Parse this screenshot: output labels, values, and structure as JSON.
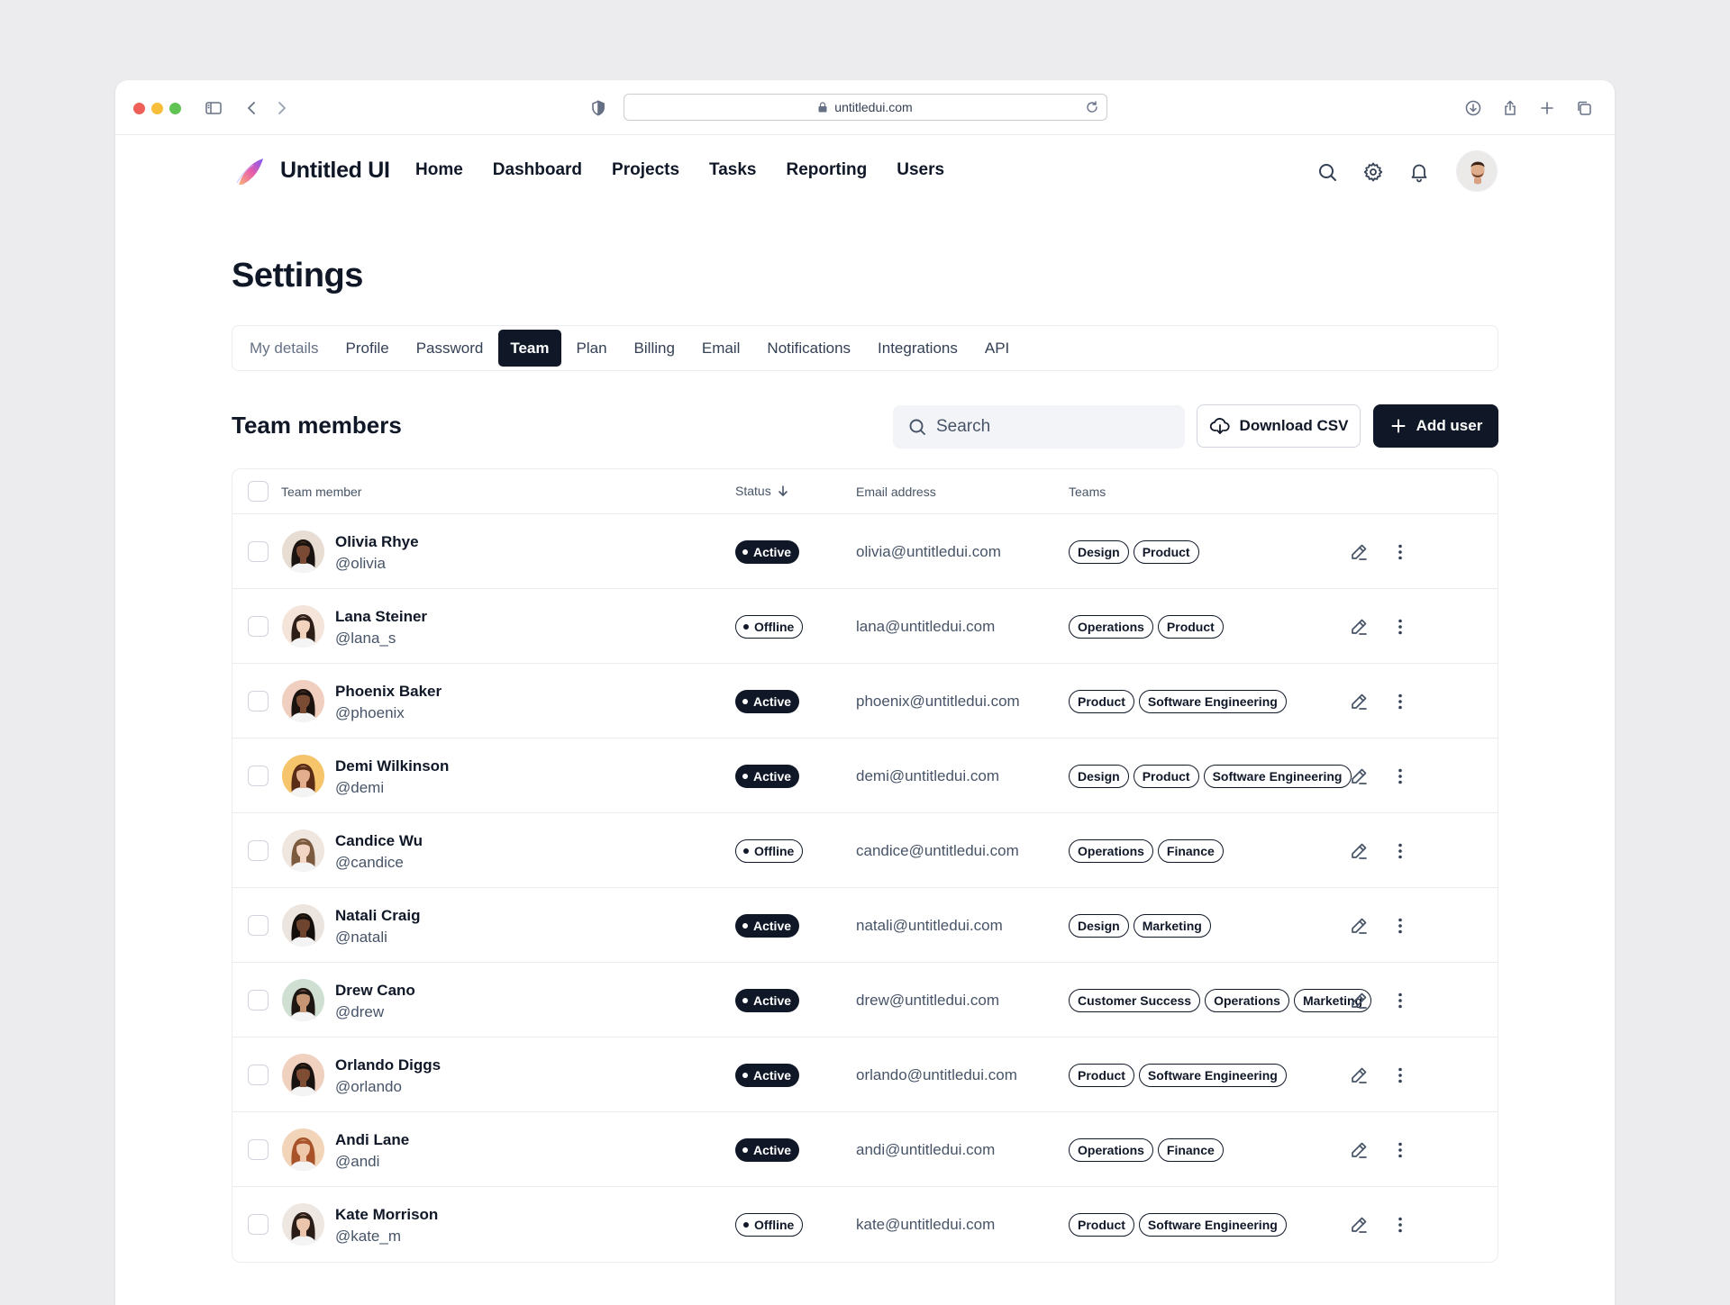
{
  "browser": {
    "url": "untitledui.com"
  },
  "brand": {
    "name": "Untitled UI"
  },
  "nav": {
    "links": [
      "Home",
      "Dashboard",
      "Projects",
      "Tasks",
      "Reporting",
      "Users"
    ],
    "icons": [
      "search-icon",
      "gear-icon",
      "bell-icon"
    ]
  },
  "page": {
    "title": "Settings"
  },
  "tabs": [
    {
      "label": "My details",
      "active": false
    },
    {
      "label": "Profile",
      "active": false
    },
    {
      "label": "Password",
      "active": false
    },
    {
      "label": "Team",
      "active": true
    },
    {
      "label": "Plan",
      "active": false
    },
    {
      "label": "Billing",
      "active": false
    },
    {
      "label": "Email",
      "active": false
    },
    {
      "label": "Notifications",
      "active": false
    },
    {
      "label": "Integrations",
      "active": false
    },
    {
      "label": "API",
      "active": false
    }
  ],
  "section": {
    "title": "Team members",
    "search_placeholder": "Search",
    "download_label": "Download CSV",
    "add_label": "Add user"
  },
  "table": {
    "headers": {
      "member": "Team member",
      "status": "Status",
      "email": "Email address",
      "teams": "Teams"
    },
    "rows": [
      {
        "name": "Olivia Rhye",
        "handle": "@olivia",
        "status": "Active",
        "email": "olivia@untitledui.com",
        "teams": [
          "Design",
          "Product"
        ],
        "skin": "#7a4a34",
        "hair": "#1a1410",
        "bg": "#e7ddd2"
      },
      {
        "name": "Lana Steiner",
        "handle": "@lana_s",
        "status": "Offline",
        "email": "lana@untitledui.com",
        "teams": [
          "Operations",
          "Product"
        ],
        "skin": "#f2d3bd",
        "hair": "#2d1f18",
        "bg": "#f4e4da"
      },
      {
        "name": "Phoenix Baker",
        "handle": "@phoenix",
        "status": "Active",
        "email": "phoenix@untitledui.com",
        "teams": [
          "Product",
          "Software Engineering"
        ],
        "skin": "#7b4b33",
        "hair": "#1b130f",
        "bg": "#f1cfc0"
      },
      {
        "name": "Demi Wilkinson",
        "handle": "@demi",
        "status": "Active",
        "email": "demi@untitledui.com",
        "teams": [
          "Design",
          "Product",
          "Software Engineering"
        ],
        "skin": "#e2ae8e",
        "hair": "#5a2c16",
        "bg": "#f6c46a"
      },
      {
        "name": "Candice Wu",
        "handle": "@candice",
        "status": "Offline",
        "email": "candice@untitledui.com",
        "teams": [
          "Operations",
          "Finance"
        ],
        "skin": "#f3d6c3",
        "hair": "#7b5a3e",
        "bg": "#efe6df"
      },
      {
        "name": "Natali Craig",
        "handle": "@natali",
        "status": "Active",
        "email": "natali@untitledui.com",
        "teams": [
          "Design",
          "Marketing"
        ],
        "skin": "#6e442e",
        "hair": "#150f0c",
        "bg": "#ece5df"
      },
      {
        "name": "Drew Cano",
        "handle": "@drew",
        "status": "Active",
        "email": "drew@untitledui.com",
        "teams": [
          "Customer Success",
          "Operations",
          "Marketing"
        ],
        "skin": "#c69674",
        "hair": "#1d1612",
        "bg": "#cfe0d3"
      },
      {
        "name": "Orlando Diggs",
        "handle": "@orlando",
        "status": "Active",
        "email": "orlando@untitledui.com",
        "teams": [
          "Product",
          "Software Engineering"
        ],
        "skin": "#7e4d33",
        "hair": "#181210",
        "bg": "#f0d1c0"
      },
      {
        "name": "Andi Lane",
        "handle": "@andi",
        "status": "Active",
        "email": "andi@untitledui.com",
        "teams": [
          "Operations",
          "Finance"
        ],
        "skin": "#efc7a9",
        "hair": "#a9532a",
        "bg": "#f2d4b9"
      },
      {
        "name": "Kate Morrison",
        "handle": "@kate_m",
        "status": "Offline",
        "email": "kate@untitledui.com",
        "teams": [
          "Product",
          "Software Engineering"
        ],
        "skin": "#ecc6ac",
        "hair": "#2a1c16",
        "bg": "#eee6e1"
      }
    ]
  },
  "colors": {
    "primary": "#101828",
    "text_secondary": "#475467",
    "border": "#eaecf0"
  }
}
